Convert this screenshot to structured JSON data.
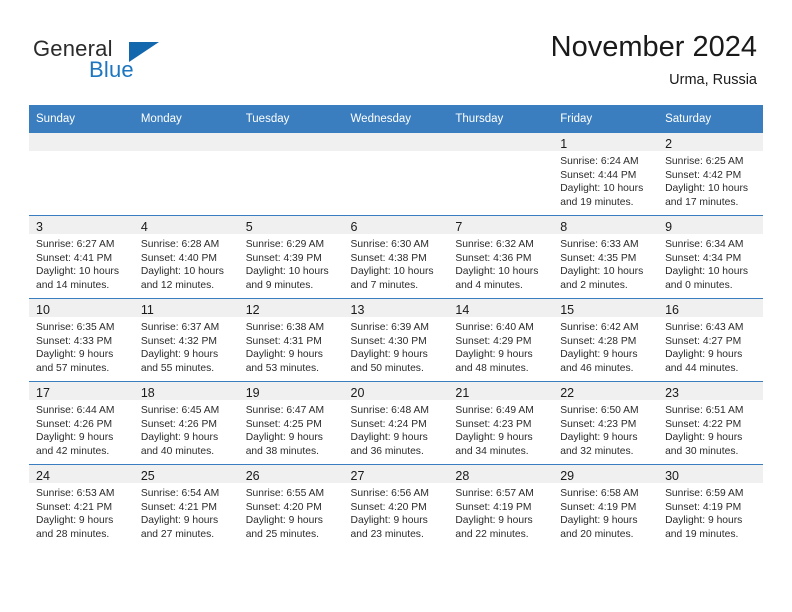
{
  "brand": {
    "name_part1": "General",
    "name_part2": "Blue",
    "accent_color": "#1d76bf",
    "triangle_color": "#1267ad"
  },
  "header": {
    "title": "November 2024",
    "location": "Urma, Russia"
  },
  "calendar": {
    "header_background": "#3a7ebf",
    "daynum_background": "#f0f0f0",
    "weekday_headers": [
      "Sunday",
      "Monday",
      "Tuesday",
      "Wednesday",
      "Thursday",
      "Friday",
      "Saturday"
    ],
    "weeks": [
      [
        {
          "empty": true
        },
        {
          "empty": true
        },
        {
          "empty": true
        },
        {
          "empty": true
        },
        {
          "empty": true
        },
        {
          "empty": false,
          "day": "1",
          "sunrise": "Sunrise: 6:24 AM",
          "sunset": "Sunset: 4:44 PM",
          "daylight_line1": "Daylight: 10 hours",
          "daylight_line2": "and 19 minutes."
        },
        {
          "empty": false,
          "day": "2",
          "sunrise": "Sunrise: 6:25 AM",
          "sunset": "Sunset: 4:42 PM",
          "daylight_line1": "Daylight: 10 hours",
          "daylight_line2": "and 17 minutes."
        }
      ],
      [
        {
          "empty": false,
          "day": "3",
          "sunrise": "Sunrise: 6:27 AM",
          "sunset": "Sunset: 4:41 PM",
          "daylight_line1": "Daylight: 10 hours",
          "daylight_line2": "and 14 minutes."
        },
        {
          "empty": false,
          "day": "4",
          "sunrise": "Sunrise: 6:28 AM",
          "sunset": "Sunset: 4:40 PM",
          "daylight_line1": "Daylight: 10 hours",
          "daylight_line2": "and 12 minutes."
        },
        {
          "empty": false,
          "day": "5",
          "sunrise": "Sunrise: 6:29 AM",
          "sunset": "Sunset: 4:39 PM",
          "daylight_line1": "Daylight: 10 hours",
          "daylight_line2": "and 9 minutes."
        },
        {
          "empty": false,
          "day": "6",
          "sunrise": "Sunrise: 6:30 AM",
          "sunset": "Sunset: 4:38 PM",
          "daylight_line1": "Daylight: 10 hours",
          "daylight_line2": "and 7 minutes."
        },
        {
          "empty": false,
          "day": "7",
          "sunrise": "Sunrise: 6:32 AM",
          "sunset": "Sunset: 4:36 PM",
          "daylight_line1": "Daylight: 10 hours",
          "daylight_line2": "and 4 minutes."
        },
        {
          "empty": false,
          "day": "8",
          "sunrise": "Sunrise: 6:33 AM",
          "sunset": "Sunset: 4:35 PM",
          "daylight_line1": "Daylight: 10 hours",
          "daylight_line2": "and 2 minutes."
        },
        {
          "empty": false,
          "day": "9",
          "sunrise": "Sunrise: 6:34 AM",
          "sunset": "Sunset: 4:34 PM",
          "daylight_line1": "Daylight: 10 hours",
          "daylight_line2": "and 0 minutes."
        }
      ],
      [
        {
          "empty": false,
          "day": "10",
          "sunrise": "Sunrise: 6:35 AM",
          "sunset": "Sunset: 4:33 PM",
          "daylight_line1": "Daylight: 9 hours",
          "daylight_line2": "and 57 minutes."
        },
        {
          "empty": false,
          "day": "11",
          "sunrise": "Sunrise: 6:37 AM",
          "sunset": "Sunset: 4:32 PM",
          "daylight_line1": "Daylight: 9 hours",
          "daylight_line2": "and 55 minutes."
        },
        {
          "empty": false,
          "day": "12",
          "sunrise": "Sunrise: 6:38 AM",
          "sunset": "Sunset: 4:31 PM",
          "daylight_line1": "Daylight: 9 hours",
          "daylight_line2": "and 53 minutes."
        },
        {
          "empty": false,
          "day": "13",
          "sunrise": "Sunrise: 6:39 AM",
          "sunset": "Sunset: 4:30 PM",
          "daylight_line1": "Daylight: 9 hours",
          "daylight_line2": "and 50 minutes."
        },
        {
          "empty": false,
          "day": "14",
          "sunrise": "Sunrise: 6:40 AM",
          "sunset": "Sunset: 4:29 PM",
          "daylight_line1": "Daylight: 9 hours",
          "daylight_line2": "and 48 minutes."
        },
        {
          "empty": false,
          "day": "15",
          "sunrise": "Sunrise: 6:42 AM",
          "sunset": "Sunset: 4:28 PM",
          "daylight_line1": "Daylight: 9 hours",
          "daylight_line2": "and 46 minutes."
        },
        {
          "empty": false,
          "day": "16",
          "sunrise": "Sunrise: 6:43 AM",
          "sunset": "Sunset: 4:27 PM",
          "daylight_line1": "Daylight: 9 hours",
          "daylight_line2": "and 44 minutes."
        }
      ],
      [
        {
          "empty": false,
          "day": "17",
          "sunrise": "Sunrise: 6:44 AM",
          "sunset": "Sunset: 4:26 PM",
          "daylight_line1": "Daylight: 9 hours",
          "daylight_line2": "and 42 minutes."
        },
        {
          "empty": false,
          "day": "18",
          "sunrise": "Sunrise: 6:45 AM",
          "sunset": "Sunset: 4:26 PM",
          "daylight_line1": "Daylight: 9 hours",
          "daylight_line2": "and 40 minutes."
        },
        {
          "empty": false,
          "day": "19",
          "sunrise": "Sunrise: 6:47 AM",
          "sunset": "Sunset: 4:25 PM",
          "daylight_line1": "Daylight: 9 hours",
          "daylight_line2": "and 38 minutes."
        },
        {
          "empty": false,
          "day": "20",
          "sunrise": "Sunrise: 6:48 AM",
          "sunset": "Sunset: 4:24 PM",
          "daylight_line1": "Daylight: 9 hours",
          "daylight_line2": "and 36 minutes."
        },
        {
          "empty": false,
          "day": "21",
          "sunrise": "Sunrise: 6:49 AM",
          "sunset": "Sunset: 4:23 PM",
          "daylight_line1": "Daylight: 9 hours",
          "daylight_line2": "and 34 minutes."
        },
        {
          "empty": false,
          "day": "22",
          "sunrise": "Sunrise: 6:50 AM",
          "sunset": "Sunset: 4:23 PM",
          "daylight_line1": "Daylight: 9 hours",
          "daylight_line2": "and 32 minutes."
        },
        {
          "empty": false,
          "day": "23",
          "sunrise": "Sunrise: 6:51 AM",
          "sunset": "Sunset: 4:22 PM",
          "daylight_line1": "Daylight: 9 hours",
          "daylight_line2": "and 30 minutes."
        }
      ],
      [
        {
          "empty": false,
          "day": "24",
          "sunrise": "Sunrise: 6:53 AM",
          "sunset": "Sunset: 4:21 PM",
          "daylight_line1": "Daylight: 9 hours",
          "daylight_line2": "and 28 minutes."
        },
        {
          "empty": false,
          "day": "25",
          "sunrise": "Sunrise: 6:54 AM",
          "sunset": "Sunset: 4:21 PM",
          "daylight_line1": "Daylight: 9 hours",
          "daylight_line2": "and 27 minutes."
        },
        {
          "empty": false,
          "day": "26",
          "sunrise": "Sunrise: 6:55 AM",
          "sunset": "Sunset: 4:20 PM",
          "daylight_line1": "Daylight: 9 hours",
          "daylight_line2": "and 25 minutes."
        },
        {
          "empty": false,
          "day": "27",
          "sunrise": "Sunrise: 6:56 AM",
          "sunset": "Sunset: 4:20 PM",
          "daylight_line1": "Daylight: 9 hours",
          "daylight_line2": "and 23 minutes."
        },
        {
          "empty": false,
          "day": "28",
          "sunrise": "Sunrise: 6:57 AM",
          "sunset": "Sunset: 4:19 PM",
          "daylight_line1": "Daylight: 9 hours",
          "daylight_line2": "and 22 minutes."
        },
        {
          "empty": false,
          "day": "29",
          "sunrise": "Sunrise: 6:58 AM",
          "sunset": "Sunset: 4:19 PM",
          "daylight_line1": "Daylight: 9 hours",
          "daylight_line2": "and 20 minutes."
        },
        {
          "empty": false,
          "day": "30",
          "sunrise": "Sunrise: 6:59 AM",
          "sunset": "Sunset: 4:19 PM",
          "daylight_line1": "Daylight: 9 hours",
          "daylight_line2": "and 19 minutes."
        }
      ]
    ]
  }
}
